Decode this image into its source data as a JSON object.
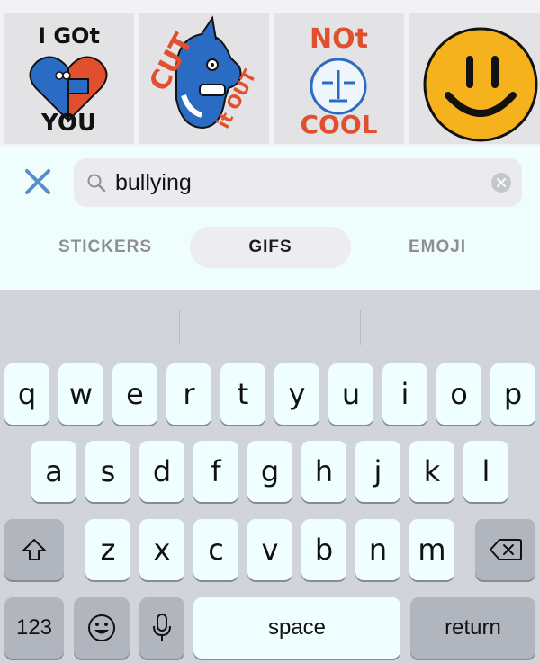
{
  "stickers": [
    {
      "name": "i-got-you",
      "line1": "I GOt",
      "line2": "YOU"
    },
    {
      "name": "cut-it-out",
      "line1": "CUT",
      "line2": "it OUT"
    },
    {
      "name": "not-cool",
      "line1": "NOt",
      "line2": "COOL"
    },
    {
      "name": "smiley",
      "line1": "",
      "line2": ""
    }
  ],
  "search": {
    "query": "bullying"
  },
  "tabs": [
    {
      "label": "STICKERS",
      "active": false
    },
    {
      "label": "GIFS",
      "active": true
    },
    {
      "label": "EMOJI",
      "active": false
    }
  ],
  "keyboard": {
    "row1": [
      "q",
      "w",
      "e",
      "r",
      "t",
      "y",
      "u",
      "i",
      "o",
      "p"
    ],
    "row2": [
      "a",
      "s",
      "d",
      "f",
      "g",
      "h",
      "j",
      "k",
      "l"
    ],
    "row3": [
      "z",
      "x",
      "c",
      "v",
      "b",
      "n",
      "m"
    ],
    "numbers_label": "123",
    "space_label": "space",
    "return_label": "return"
  },
  "colors": {
    "accent_blue": "#5a8ec6",
    "sticker_red": "#e0502e",
    "sticker_blue": "#2a6bc4",
    "smiley_yellow": "#f6b21c"
  },
  "icons": [
    "close-icon",
    "search-icon",
    "clear-icon",
    "shift-icon",
    "backspace-icon",
    "emoji-icon",
    "mic-icon"
  ]
}
